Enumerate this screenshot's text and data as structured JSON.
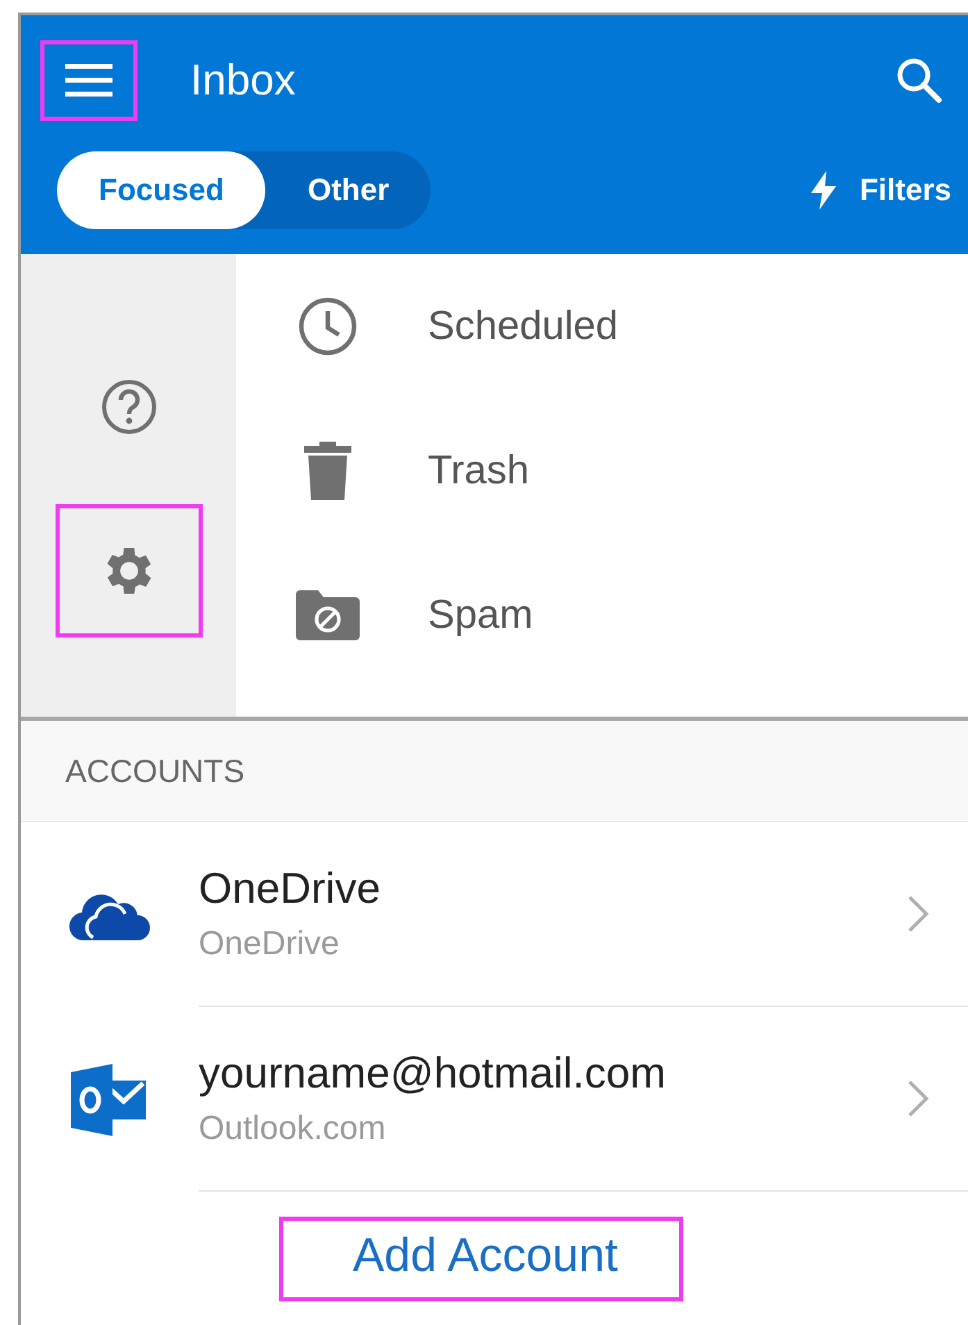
{
  "header": {
    "menu": {
      "highlighted": true
    },
    "title": "Inbox"
  },
  "tabs": [
    {
      "label": "Focused",
      "selected": true
    },
    {
      "label": "Other",
      "selected": false
    }
  ],
  "filters": {
    "label": "Filters"
  },
  "side_actions": [
    {
      "kind": "help",
      "highlighted": false
    },
    {
      "kind": "settings",
      "highlighted": true
    }
  ],
  "folders": [
    {
      "kind": "scheduled",
      "label": "Scheduled"
    },
    {
      "kind": "trash",
      "label": "Trash"
    },
    {
      "kind": "spam",
      "label": "Spam"
    }
  ],
  "accounts": {
    "heading": "ACCOUNTS",
    "items": [
      {
        "kind": "onedrive",
        "name": "OneDrive",
        "type": "OneDrive"
      },
      {
        "kind": "outlook",
        "name": "yourname@hotmail.com",
        "type": "Outlook.com"
      }
    ]
  },
  "add_account": {
    "label": "Add Account",
    "highlighted": true
  }
}
